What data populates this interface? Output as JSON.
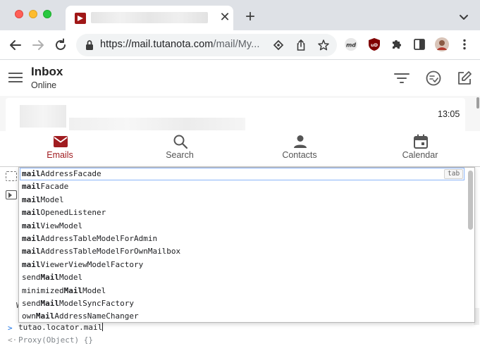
{
  "browser": {
    "tab_close_glyph": "✕",
    "new_tab_glyph": "+",
    "url_host": "https://mail.tutanota.com",
    "url_path": "/mail/My...",
    "traffic_colors": [
      "#ff5f57",
      "#febc2e",
      "#28c840"
    ],
    "favicon_color": "#a01717"
  },
  "app": {
    "title": "Inbox",
    "status": "Online",
    "mail_time": "13:05",
    "accent_color": "#a01c20",
    "nav": [
      {
        "label": "Emails",
        "icon": "envelope-icon",
        "active": true
      },
      {
        "label": "Search",
        "icon": "search-icon",
        "active": false
      },
      {
        "label": "Contacts",
        "icon": "person-icon",
        "active": false
      },
      {
        "label": "Calendar",
        "icon": "calendar-icon",
        "active": false
      }
    ]
  },
  "console": {
    "input": "tutao.locator.mail",
    "result": "Proxy(Object) {}",
    "prompt_glyph": ">",
    "result_glyph": "<·",
    "side_letter": "W",
    "tab_hint": "tab",
    "suggestions": [
      {
        "bold": "mail",
        "rest": "AddressFacade",
        "prefix": ""
      },
      {
        "bold": "mail",
        "rest": "Facade",
        "prefix": ""
      },
      {
        "bold": "mail",
        "rest": "Model",
        "prefix": ""
      },
      {
        "bold": "mail",
        "rest": "OpenedListener",
        "prefix": ""
      },
      {
        "bold": "mail",
        "rest": "ViewModel",
        "prefix": ""
      },
      {
        "bold": "mail",
        "rest": "AddressTableModelForAdmin",
        "prefix": ""
      },
      {
        "bold": "mail",
        "rest": "AddressTableModelForOwnMailbox",
        "prefix": ""
      },
      {
        "bold": "mail",
        "rest": "ViewerViewModelFactory",
        "prefix": ""
      },
      {
        "bold": "Mail",
        "rest": "Model",
        "prefix": "send"
      },
      {
        "bold": "Mail",
        "rest": "Model",
        "prefix": "minimized"
      },
      {
        "bold": "Mail",
        "rest": "ModelSyncFactory",
        "prefix": "send"
      },
      {
        "bold": "Mail",
        "rest": "AddressNameChanger",
        "prefix": "own"
      }
    ]
  }
}
